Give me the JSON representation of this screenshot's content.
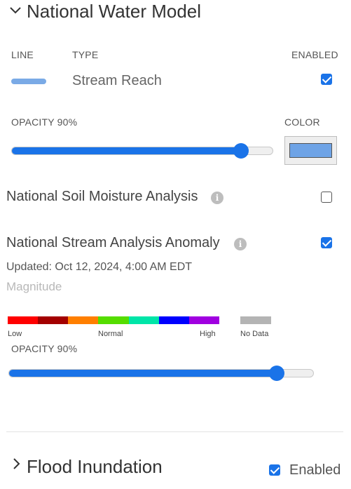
{
  "nwm": {
    "title": "National Water Model",
    "col_line": "LINE",
    "col_type": "TYPE",
    "col_enabled": "ENABLED",
    "line_color": "#7aaae6",
    "type_value": "Stream Reach",
    "enabled": true,
    "opacity_label": "OPACITY 90%",
    "opacity_value": 0.9,
    "color_label": "COLOR",
    "color_value": "#6ea3e6"
  },
  "soil": {
    "label": "National Soil Moisture Analysis",
    "info_icon": "info-icon",
    "enabled": false
  },
  "stream_anomaly": {
    "label": "National Stream Analysis Anomaly",
    "info_icon": "info-icon",
    "enabled": true,
    "updated": "Updated: Oct 12, 2024, 4:00 AM EDT",
    "magnitude_label": "Magnitude",
    "legend_colors": [
      "#ff0000",
      "#a30000",
      "#ff7f00",
      "#55dd00",
      "#00e5a8",
      "#0000ff",
      "#a000e0"
    ],
    "legend_low": "Low",
    "legend_normal": "Normal",
    "legend_high": "High",
    "nodata_color": "#b4b4b4",
    "nodata_label": "No Data",
    "opacity_label": "OPACITY 90%",
    "opacity_value": 0.9
  },
  "flood": {
    "title": "Flood Inundation",
    "enabled_label": "Enabled",
    "enabled": true
  },
  "icons": {
    "expand": "chevron-down-icon",
    "collapse": "chevron-right-icon"
  },
  "accent": "#1a73e8"
}
